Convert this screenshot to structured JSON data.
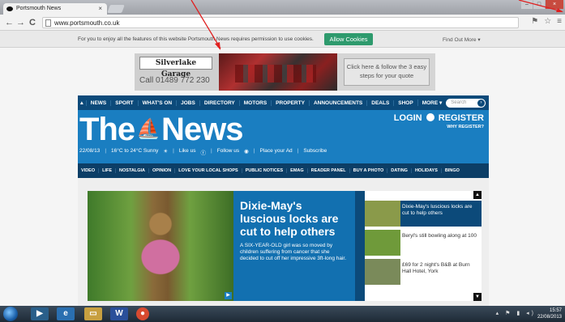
{
  "browser": {
    "tab_title": "Portsmouth News",
    "tab_close": "×",
    "url": "www.portsmouth.co.uk",
    "nav_back": "←",
    "nav_forward": "→",
    "nav_reload": "C"
  },
  "cookie_bar": {
    "text": "For you to enjoy all the features of this website Portsmouth News requires permission to use cookies.",
    "button": "Allow Cookies",
    "more": "Find Out More ▾"
  },
  "ad": {
    "name": "Silverlake Garage",
    "phone": "Call 01489 772 230",
    "cta": "Click here & follow the 3 easy steps for your quote"
  },
  "nav": {
    "items": [
      "NEWS",
      "SPORT",
      "WHAT'S ON",
      "JOBS",
      "DIRECTORY",
      "MOTORS",
      "PROPERTY",
      "ANNOUNCEMENTS",
      "DEALS",
      "SHOP",
      "MORE ▾"
    ],
    "search_placeholder": "Search"
  },
  "masthead": {
    "logo_left": "The",
    "logo_right": "News",
    "login": "LOGIN",
    "register": "REGISTER",
    "why_register": "WHY REGISTER?",
    "date": "22/08/13",
    "weather": "16°C to 24°C Sunny",
    "like": "Like us",
    "follow": "Follow us",
    "place_ad": "Place your Ad",
    "subscribe": "Subscribe"
  },
  "subnav": {
    "items": [
      "VIDEO",
      "LIFE",
      "NOSTALGIA",
      "OPINION",
      "LOVE YOUR LOCAL SHOPS",
      "PUBLIC NOTICES",
      "EMAG",
      "READER PANEL",
      "BUY A PHOTO",
      "DATING",
      "HOLIDAYS",
      "BINGO"
    ]
  },
  "feature": {
    "title": "Dixie-May's luscious locks are cut to help others",
    "desc": "A SIX-YEAR-OLD girl was so moved by children suffering from cancer that she decided to cut off her impressive 3ft-long hair.",
    "side": [
      {
        "text": "Dixie-May's luscious locks are cut to help others",
        "thumb": "#8a9a4a"
      },
      {
        "text": "Beryl's still bowling along at 100",
        "thumb": "#6f9a3a"
      },
      {
        "text": "£69 for 2 night's B&B at Burn Hall Hotel, York",
        "thumb": "#7a8a5a"
      }
    ]
  },
  "taskbar": {
    "time": "15:57",
    "date": "22/08/2013"
  }
}
